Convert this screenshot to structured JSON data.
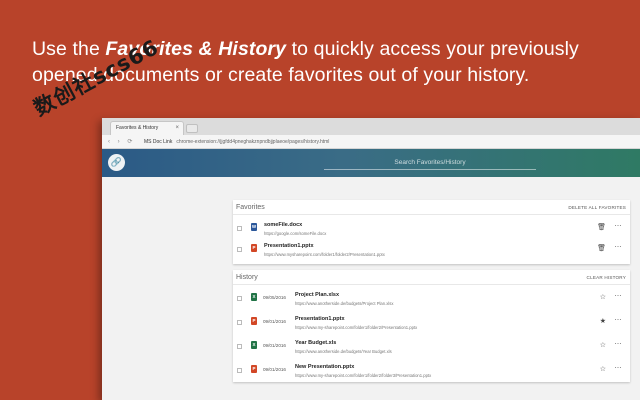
{
  "headline": {
    "prefix": "Use the ",
    "emphasis": "Favorites & History",
    "suffix": " to quickly access your previously opened documents or create favorites out of your history."
  },
  "watermark": {
    "text": "数创社scs66"
  },
  "browser": {
    "tab_title": "Favorites & History",
    "tab_close": "×",
    "nav_glyphs": "‹ › ⟳",
    "site_name": "MS Doc Link",
    "url": "chrome-extension://jjgfdd4pneghakznpndbjjplaeoe/pages/history.html"
  },
  "app": {
    "logo_glyph": "🔗",
    "search_placeholder": "Search Favorites/History"
  },
  "favorites": {
    "title": "Favorites",
    "action": "DELETE ALL FAVORITES",
    "items": [
      {
        "icon": "word-file-icon",
        "type_letter": "W",
        "name": "someFile.docx",
        "url": "https://google.com/someFile.docx",
        "act1": "🗑",
        "act2": "⋯"
      },
      {
        "icon": "powerpoint-file-icon",
        "type_letter": "P",
        "name": "Presentation1.pptx",
        "url": "https://www.mysharepoint.com/folder1/folder2/Presentation1.pptx",
        "act1": "🗑",
        "act2": "⋯"
      }
    ]
  },
  "history": {
    "title": "History",
    "action": "CLEAR HISTORY",
    "items": [
      {
        "icon": "excel-file-icon",
        "type_letter": "X",
        "date": "09/05/2016",
        "name": "Project Plan.xlsx",
        "url": "https://www.anotherside.de/budgets/Project Plan.xlsx",
        "act1": "☆",
        "act2": "⋯"
      },
      {
        "icon": "powerpoint-file-icon",
        "type_letter": "P",
        "date": "09/01/2016",
        "name": "Presentation1.pptx",
        "url": "https://www.my-sharepoint.com/folder1/folder2/Presentation1.pptx",
        "act1": "★",
        "act2": "⋯"
      },
      {
        "icon": "excel-file-icon",
        "type_letter": "X",
        "date": "09/01/2016",
        "name": "Year Budget.xls",
        "url": "https://www.anotherside.de/budgets/Year Budget.xls",
        "act1": "☆",
        "act2": "⋯"
      },
      {
        "icon": "powerpoint-file-icon",
        "type_letter": "P",
        "date": "09/01/2016",
        "name": "New Presentation.pptx",
        "url": "https://www.my-sharepoint.com/folder1/folder2/folder3/Presentation1.pptx",
        "act1": "☆",
        "act2": "⋯"
      }
    ]
  }
}
